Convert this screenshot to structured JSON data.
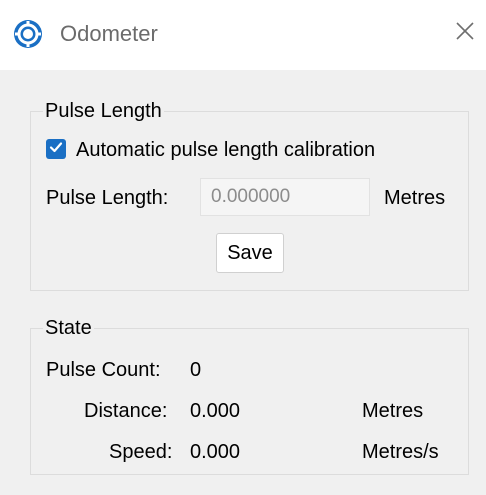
{
  "window": {
    "title": "Odometer",
    "close_glyph": "✕"
  },
  "pulse_length_group": {
    "legend": "Pulse Length",
    "auto_calibration_label": "Automatic pulse length calibration",
    "auto_calibration_checked": true,
    "pulse_length_label": "Pulse Length:",
    "pulse_length_value": "0.000000",
    "pulse_length_unit": "Metres",
    "save_label": "Save"
  },
  "state_group": {
    "legend": "State",
    "pulse_count_label": "Pulse Count:",
    "pulse_count_value": "0",
    "distance_label": "Distance:",
    "distance_value": "0.000",
    "distance_unit": "Metres",
    "speed_label": "Speed:",
    "speed_value": "0.000",
    "speed_unit": "Metres/s"
  },
  "icons": {
    "app": "odometer-app-icon",
    "close": "close-icon",
    "check": "checkmark-icon"
  },
  "colors": {
    "accent": "#1a6fc4",
    "window_bg": "#f0f0f0",
    "titlebar_bg": "#ffffff",
    "disabled_text": "#8c8c8c"
  }
}
